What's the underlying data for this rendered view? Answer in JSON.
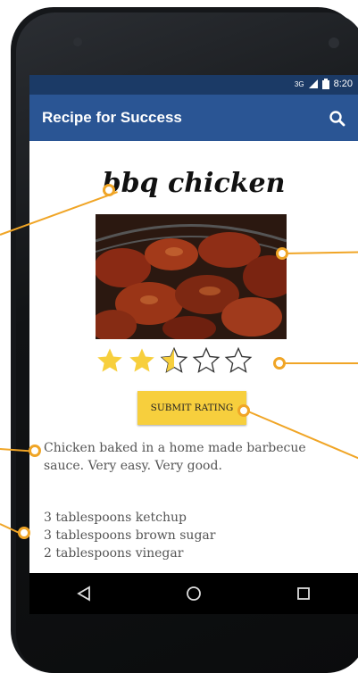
{
  "status_bar": {
    "network": "3G",
    "time": "8:20"
  },
  "app_bar": {
    "title": "Recipe for Success",
    "search_icon": "search-icon"
  },
  "recipe": {
    "title": "bbq chicken",
    "photo_alt": "",
    "rating": {
      "value": 2.5,
      "max": 5
    },
    "submit_label": "SUBMIT RATING",
    "description": "Chicken baked in a home made barbecue sauce. Very easy. Very good.",
    "ingredients": [
      "3 tablespoons ketchup",
      "3 tablespoons brown sugar",
      "2 tablespoons vinegar"
    ]
  },
  "nav_bar": {
    "back_icon": "back-triangle-icon",
    "home_icon": "home-circle-icon",
    "recents_icon": "recents-square-icon"
  },
  "colors": {
    "status_bar": "#1b3a66",
    "app_bar": "#2a5594",
    "star_fill": "#f7cf3d",
    "submit_button": "#f7cf3d",
    "callout": "#f0a526"
  }
}
